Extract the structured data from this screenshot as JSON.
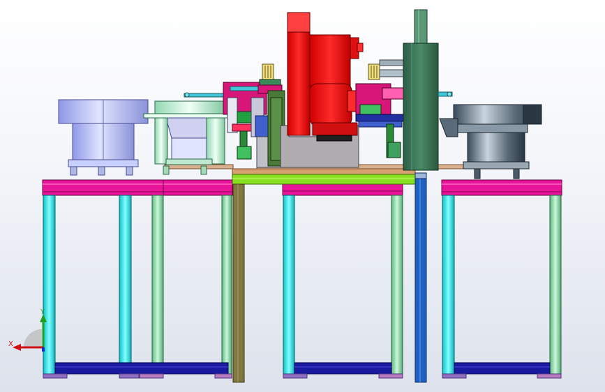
{
  "viewport": {
    "background": "#eef1f6"
  },
  "triad": {
    "x_label": "X",
    "y_label": "Y",
    "x_color": "#d01010",
    "y_color": "#20a020",
    "z_color": "#1030d0"
  },
  "colors": {
    "frame_magenta": "#e8159a",
    "leg_cyan": "#33ffff",
    "leg_green": "#90e0a8",
    "base_navy": "#1a1aa0",
    "robot_red": "#ff1010",
    "tower_green": "#3a7a5a",
    "bowl_lavender": "#b8c0f8",
    "bowl_mint": "#c8f0d8",
    "bowl_steel": "#6b7b8a",
    "plate_tan": "#d8b090",
    "beam_lime": "#88e020",
    "column_olive": "#807840",
    "column_blue": "#2060c0"
  }
}
